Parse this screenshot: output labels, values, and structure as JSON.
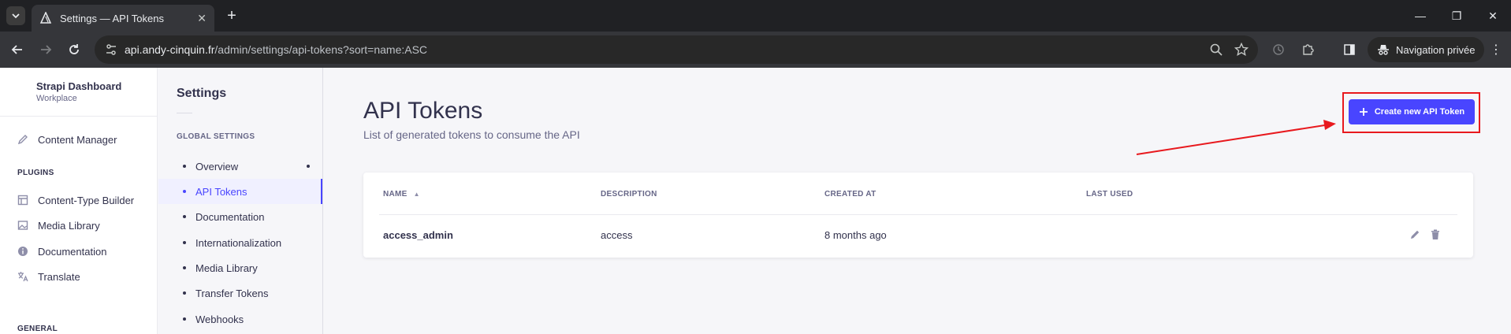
{
  "browser": {
    "tab_title": "Settings — API Tokens",
    "url_host": "api.andy-cinquin.fr",
    "url_path": "/admin/settings/api-tokens?sort=name:ASC",
    "private_label": "Navigation privée"
  },
  "app": {
    "brand_name": "Strapi Dashboard",
    "brand_sub": "Workplace",
    "nav": {
      "content_manager": "Content Manager",
      "plugins_section": "PLUGINS",
      "plugins": [
        {
          "label": "Content-Type Builder",
          "icon": "layout-icon"
        },
        {
          "label": "Media Library",
          "icon": "image-icon"
        },
        {
          "label": "Documentation",
          "icon": "info-icon"
        },
        {
          "label": "Translate",
          "icon": "translate-icon"
        }
      ],
      "general_section": "GENERAL"
    }
  },
  "settings": {
    "title": "Settings",
    "section": "GLOBAL SETTINGS",
    "links": [
      {
        "label": "Overview"
      },
      {
        "label": "API Tokens"
      },
      {
        "label": "Documentation"
      },
      {
        "label": "Internationalization"
      },
      {
        "label": "Media Library"
      },
      {
        "label": "Transfer Tokens"
      },
      {
        "label": "Webhooks"
      }
    ]
  },
  "page": {
    "title": "API Tokens",
    "subtitle": "List of generated tokens to consume the API",
    "create_button": "Create new API Token",
    "accent_color": "#4945ff",
    "annotation_color": "#e8191e"
  },
  "table": {
    "columns": [
      "NAME",
      "DESCRIPTION",
      "CREATED AT",
      "LAST USED"
    ],
    "rows": [
      {
        "name": "access_admin",
        "description": "access",
        "created_at": "8 months ago",
        "last_used": ""
      }
    ]
  }
}
